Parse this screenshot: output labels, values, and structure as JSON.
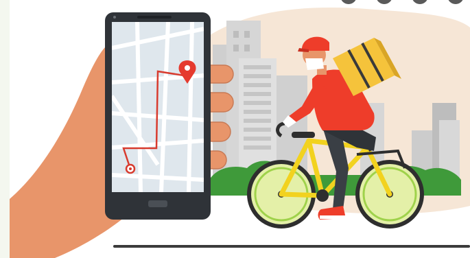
{
  "image": {
    "subject": "delivery-illustration",
    "colors": {
      "background": "#f4f7ef",
      "panel": "#ffffff",
      "blob": "#f6e6d6",
      "buildings": "#d3d3d3",
      "phone": "#2f3338",
      "map_road": "#ffffff",
      "map_block": "#dfe7ed",
      "route": "#d83b2e",
      "pin": "#e53a2e",
      "hand": "#e8956a",
      "bike_frame": "#f2d21f",
      "wheel_fill": "#e4f0a8",
      "shirt": "#ee3d2a",
      "backpack": "#f5c33b",
      "bush": "#3f9a3a",
      "ground": "#3b3b3b"
    },
    "icons": [
      "map-pin-icon",
      "route-start-icon",
      "home-button-icon"
    ]
  }
}
